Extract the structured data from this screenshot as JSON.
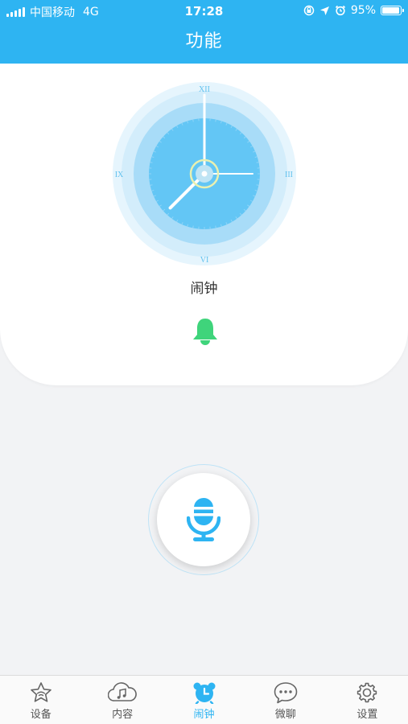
{
  "status_bar": {
    "carrier": "中国移动",
    "network": "4G",
    "time": "17:28",
    "battery_text": "95%",
    "battery_level": 0.95
  },
  "header": {
    "title": "功能"
  },
  "clock": {
    "label": "闹钟",
    "numerals": {
      "top": "XII",
      "right": "III",
      "bottom": "VI",
      "left": "IX"
    },
    "hands": {
      "hour": 7.5,
      "minute": 0,
      "second": 15
    }
  },
  "voice": {
    "icon": "microphone-icon"
  },
  "tabs": [
    {
      "label": "设备",
      "icon": "star-icon",
      "active": false
    },
    {
      "label": "内容",
      "icon": "music-cloud-icon",
      "active": false
    },
    {
      "label": "闹钟",
      "icon": "alarm-clock-icon",
      "active": true
    },
    {
      "label": "微聊",
      "icon": "chat-bubble-icon",
      "active": false
    },
    {
      "label": "设置",
      "icon": "gear-icon",
      "active": false
    }
  ],
  "colors": {
    "primary": "#2eb4f2",
    "bell": "#3fd47b"
  }
}
